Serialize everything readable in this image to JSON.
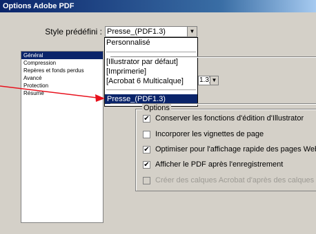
{
  "window": {
    "title": "Options Adobe PDF"
  },
  "preset": {
    "label": "Style prédéfini :",
    "value": "Presse_(PDF1.3)",
    "dropdown_arrow": "▼",
    "options": [
      "Personnalisé",
      "[Illustrator par défaut]",
      "[Imprimerie]",
      "[Acrobat 6 Multicalque]",
      "Presse_(PDF1.3)"
    ]
  },
  "nav": {
    "items": [
      "Général",
      "Compression",
      "Repères et fonds perdus",
      "Avancé",
      "Protection",
      "Résumé"
    ],
    "selected_index": 0
  },
  "compat": {
    "value": "1.3)",
    "dropdown_arrow": "▼"
  },
  "options_group": {
    "label": "Options",
    "items": [
      {
        "label": "Conserver les fonctions d'édition d'Illustrator",
        "checked": true,
        "enabled": true
      },
      {
        "label": "Incorporer les vignettes de page",
        "checked": false,
        "enabled": true
      },
      {
        "label": "Optimiser pour l'affichage rapide des pages Web",
        "checked": true,
        "enabled": true
      },
      {
        "label": "Afficher le PDF après l'enregistrement",
        "checked": true,
        "enabled": true
      },
      {
        "label": "Créer des calques Acrobat d'après des calques de niv",
        "checked": false,
        "enabled": false
      }
    ],
    "check_glyph": "✔"
  },
  "colors": {
    "annotation_arrow": "#e8101c",
    "selection": "#0a246a"
  }
}
